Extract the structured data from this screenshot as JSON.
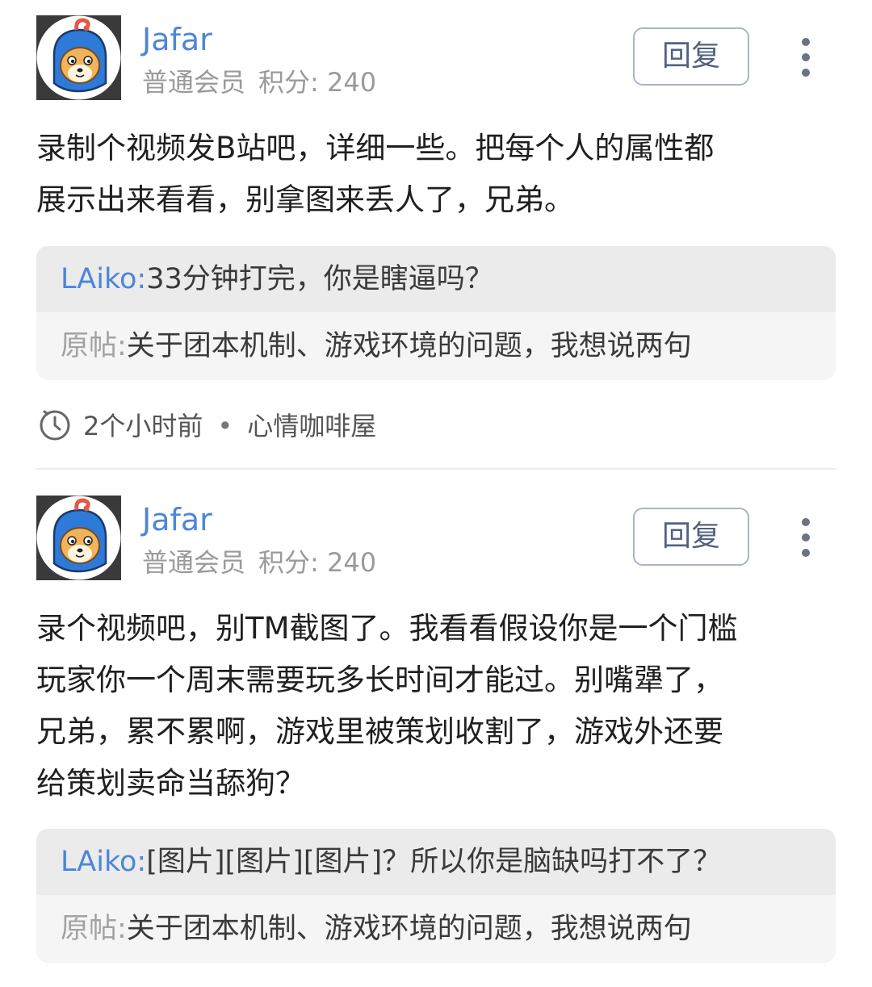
{
  "posts": [
    {
      "username": "Jafar",
      "member_level": "普通会员",
      "points_label": "积分: 240",
      "reply_label": "回复",
      "body": "录制个视频发B站吧，详细一些。把每个人的属性都\n展示出来看看，别拿图来丢人了，兄弟。",
      "quote": {
        "user": "LAiko",
        "separator": ":",
        "text": "33分钟打完，你是瞎逼吗？",
        "original_label": "原帖:",
        "original_title": "关于团本机制、游戏环境的问题，我想说两句"
      },
      "time": "2个小时前",
      "meta_dot": "•",
      "forum": "心情咖啡屋"
    },
    {
      "username": "Jafar",
      "member_level": "普通会员",
      "points_label": "积分: 240",
      "reply_label": "回复",
      "body": "录个视频吧，别TM截图了。我看看假设你是一个门槛\n玩家你一个周末需要玩多长时间才能过。别嘴犟了，\n兄弟，累不累啊，游戏里被策划收割了，游戏外还要\n给策划卖命当舔狗？",
      "quote": {
        "user": "LAiko",
        "separator": ":",
        "text": "[图片][图片][图片]？所以你是脑缺吗打不了？",
        "original_label": "原帖:",
        "original_title": "关于团本机制、游戏环境的问题，我想说两句"
      }
    }
  ],
  "icons": {
    "avatar": "shiba-dog-avatar-icon",
    "more": "more-vertical-icon",
    "clock": "clock-icon"
  },
  "colors": {
    "username": "#4c86d9",
    "reply_border": "#aab4c8",
    "quote_top_bg": "#ebebeb",
    "quote_bottom_bg": "#f5f5f5"
  }
}
